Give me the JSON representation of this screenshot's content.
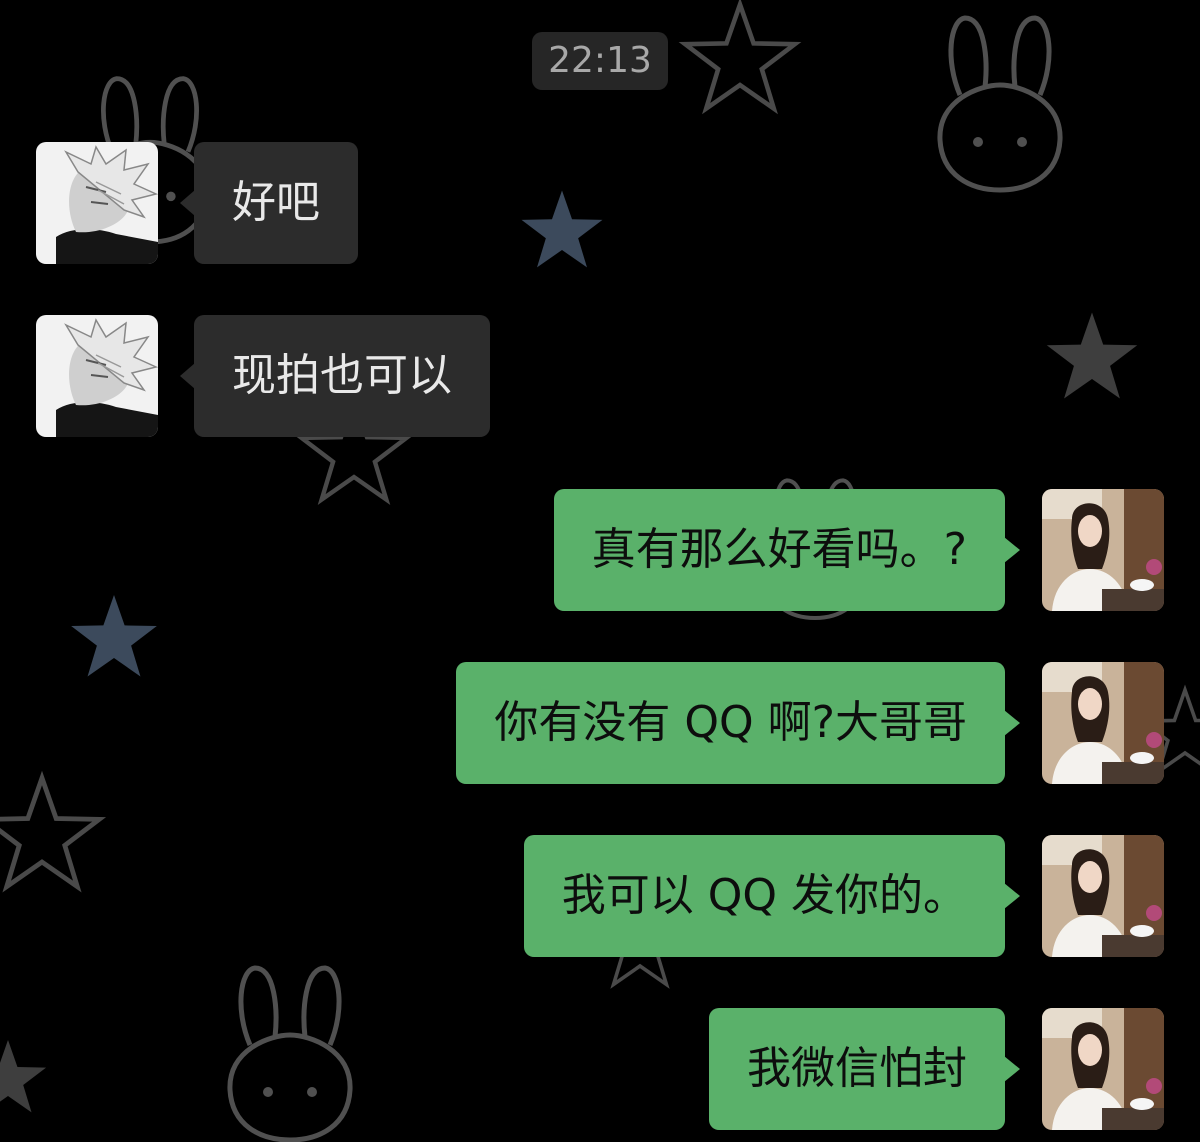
{
  "chat": {
    "timestamp": "22:13",
    "background_pattern": [
      "star-icon",
      "bunny-face-icon"
    ],
    "colors": {
      "background": "#000000",
      "incoming_bubble": "#2c2c2c",
      "outgoing_bubble": "#5ab16a",
      "timestamp_bg": "#262626"
    },
    "messages": [
      {
        "sender": "contact",
        "avatar": "anime-white-hair-avatar",
        "text": "好吧"
      },
      {
        "sender": "contact",
        "avatar": "anime-white-hair-avatar",
        "text": "现拍也可以"
      },
      {
        "sender": "me",
        "avatar": "girl-photo-avatar",
        "text": "真有那么好看吗。?"
      },
      {
        "sender": "me",
        "avatar": "girl-photo-avatar",
        "text": "你有没有 QQ 啊?大哥哥"
      },
      {
        "sender": "me",
        "avatar": "girl-photo-avatar",
        "text": "我可以 QQ 发你的。"
      },
      {
        "sender": "me",
        "avatar": "girl-photo-avatar",
        "text": "我微信怕封"
      }
    ]
  }
}
